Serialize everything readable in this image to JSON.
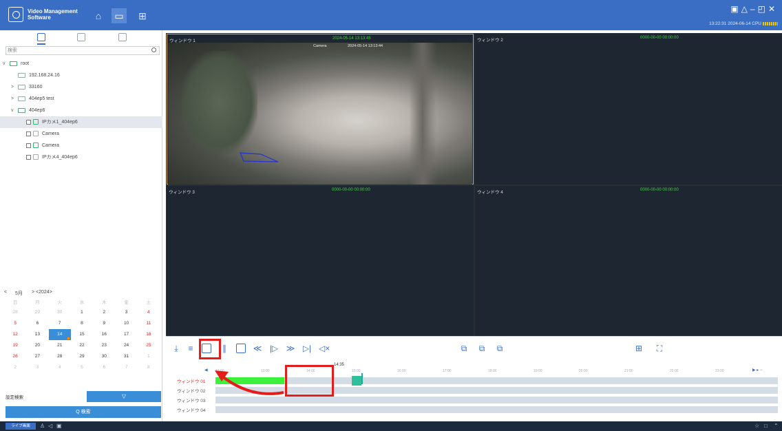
{
  "app": {
    "title_line1": "Video Management",
    "title_line2": "Software",
    "status_text": "13:22:31 2024-06-14 CPU"
  },
  "left_panel": {
    "search_placeholder": "検索",
    "tree": [
      {
        "label": "root",
        "caret": "v",
        "kind": "folder",
        "indent": 0
      },
      {
        "label": "192.168.24.16",
        "caret": "",
        "kind": "folder-gray",
        "indent": 1
      },
      {
        "label": "33160",
        "caret": ">",
        "kind": "folder-gray",
        "indent": 1
      },
      {
        "label": "404ep5 test",
        "caret": ">",
        "kind": "folder-gray",
        "indent": 1
      },
      {
        "label": "404ep6",
        "caret": "v",
        "kind": "folder",
        "indent": 1
      },
      {
        "label": "IPカメ1_404ep6",
        "caret": "",
        "kind": "cam",
        "indent": 2,
        "selected": true
      },
      {
        "label": "Camera",
        "caret": "",
        "kind": "cam-gray",
        "indent": 2
      },
      {
        "label": "Camera",
        "caret": "",
        "kind": "cam",
        "indent": 2
      },
      {
        "label": "IPカメ4_404ep6",
        "caret": "",
        "kind": "cam-gray",
        "indent": 2
      }
    ],
    "calendar": {
      "prev": "<",
      "month": "5月",
      "year_nav": "> <2024>",
      "weekdays": [
        "日",
        "月",
        "火",
        "水",
        "木",
        "金",
        "土"
      ],
      "rows": [
        [
          "28",
          "29",
          "30",
          "1",
          "2",
          "3",
          "4"
        ],
        [
          "5",
          "6",
          "7",
          "8",
          "9",
          "10",
          "11"
        ],
        [
          "12",
          "13",
          "14",
          "15",
          "16",
          "17",
          "18"
        ],
        [
          "19",
          "20",
          "21",
          "22",
          "23",
          "24",
          "25"
        ],
        [
          "26",
          "27",
          "28",
          "29",
          "30",
          "31",
          "1"
        ],
        [
          "2",
          "3",
          "4",
          "5",
          "6",
          "7",
          "8"
        ]
      ],
      "today": "14"
    },
    "condition_label": "設定検索",
    "condition_button": "▽",
    "search_button": "Q 検索"
  },
  "video_windows": [
    {
      "label": "ウィンドウ 1",
      "time": "2024-05-14 13:13:45",
      "overlay_left": "Camera",
      "overlay_right": "2024-05-14 13:13:44"
    },
    {
      "label": "ウィンドウ 2",
      "time": "0000-00-00 00:00:00"
    },
    {
      "label": "ウィンドウ 3",
      "time": "0000-00-00 00:00:00"
    },
    {
      "label": "ウィンドウ 4",
      "time": "0000-00-00 00:00:00"
    }
  ],
  "timeline": {
    "current_time": "14:35",
    "ticks": [
      "12:00",
      "13:00",
      "14:00",
      "15:00",
      "16:00",
      "17:00",
      "18:00",
      "19:00",
      "20:00",
      "21:00",
      "22:00",
      "23:00"
    ],
    "rows": [
      {
        "label": "ウィンドウ 01",
        "active": true
      },
      {
        "label": "ウィンドウ 02",
        "active": false
      },
      {
        "label": "ウィンドウ 03",
        "active": false
      },
      {
        "label": "ウィンドウ 04",
        "active": false
      }
    ]
  },
  "taskbar": {
    "button": "ライブ画面"
  },
  "colors": {
    "accent": "#3a6ec4",
    "highlight": "#e41c1c",
    "record": "#3cf03c"
  }
}
